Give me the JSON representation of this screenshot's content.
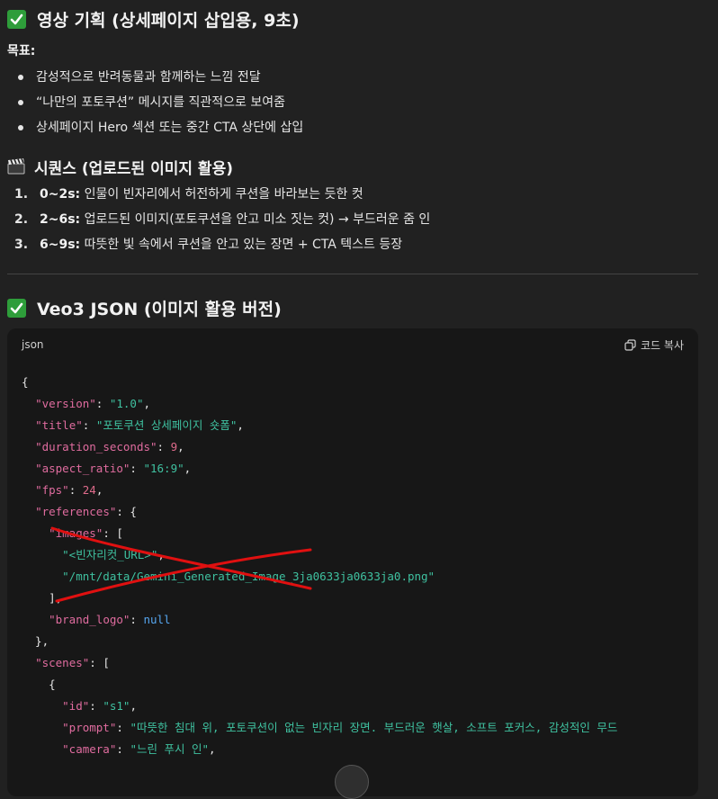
{
  "section1": {
    "title": "영상 기획 (상세페이지 삽입용, 9초)",
    "goal_label": "목표:",
    "goals": [
      "감성적으로 반려동물과 함께하는 느낌 전달",
      "“나만의 포토쿠션” 메시지를 직관적으로 보여줌",
      "상세페이지 Hero 섹션 또는 중간 CTA 상단에 삽입"
    ]
  },
  "section2": {
    "title": "시퀀스 (업로드된 이미지 활용)",
    "steps": [
      {
        "num": "1.",
        "time": "0~2s:",
        "text": " 인물이 빈자리에서 허전하게 쿠션을 바라보는 듯한 컷"
      },
      {
        "num": "2.",
        "time": "2~6s:",
        "text": " 업로드된 이미지(포토쿠션을 안고 미소 짓는 컷) → 부드러운 줌 인"
      },
      {
        "num": "3.",
        "time": "6~9s:",
        "text": " 따뜻한 빛 속에서 쿠션을 안고 있는 장면 + CTA 텍스트 등장"
      }
    ]
  },
  "section3": {
    "title": "Veo3 JSON (이미지 활용 버전)"
  },
  "code_block": {
    "language": "json",
    "copy_label": "코드 복사",
    "lines": [
      [
        [
          "p",
          "{"
        ]
      ],
      [
        [
          "p",
          "  "
        ],
        [
          "k",
          "\"version\""
        ],
        [
          "p",
          ": "
        ],
        [
          "s",
          "\"1.0\""
        ],
        [
          "p",
          ","
        ]
      ],
      [
        [
          "p",
          "  "
        ],
        [
          "k",
          "\"title\""
        ],
        [
          "p",
          ": "
        ],
        [
          "s",
          "\"포토쿠션 상세페이지 숏폼\""
        ],
        [
          "p",
          ","
        ]
      ],
      [
        [
          "p",
          "  "
        ],
        [
          "k",
          "\"duration_seconds\""
        ],
        [
          "p",
          ": "
        ],
        [
          "n",
          "9"
        ],
        [
          "p",
          ","
        ]
      ],
      [
        [
          "p",
          "  "
        ],
        [
          "k",
          "\"aspect_ratio\""
        ],
        [
          "p",
          ": "
        ],
        [
          "s",
          "\"16:9\""
        ],
        [
          "p",
          ","
        ]
      ],
      [
        [
          "p",
          "  "
        ],
        [
          "k",
          "\"fps\""
        ],
        [
          "p",
          ": "
        ],
        [
          "n",
          "24"
        ],
        [
          "p",
          ","
        ]
      ],
      [
        [
          "p",
          "  "
        ],
        [
          "k",
          "\"references\""
        ],
        [
          "p",
          ": {"
        ]
      ],
      [
        [
          "p",
          "    "
        ],
        [
          "k",
          "\"images\""
        ],
        [
          "p",
          ": ["
        ]
      ],
      [
        [
          "p",
          "      "
        ],
        [
          "s",
          "\"<빈자리컷_URL>\""
        ],
        [
          "p",
          ","
        ]
      ],
      [
        [
          "p",
          "      "
        ],
        [
          "s",
          "\"/mnt/data/Gemini_Generated_Image_3ja0633ja0633ja0.png\""
        ]
      ],
      [
        [
          "p",
          "    ],"
        ]
      ],
      [
        [
          "p",
          "    "
        ],
        [
          "k",
          "\"brand_logo\""
        ],
        [
          "p",
          ": "
        ],
        [
          "nl",
          "null"
        ]
      ],
      [
        [
          "p",
          "  },"
        ]
      ],
      [
        [
          "p",
          "  "
        ],
        [
          "k",
          "\"scenes\""
        ],
        [
          "p",
          ": ["
        ]
      ],
      [
        [
          "p",
          "    {"
        ]
      ],
      [
        [
          "p",
          "      "
        ],
        [
          "k",
          "\"id\""
        ],
        [
          "p",
          ": "
        ],
        [
          "s",
          "\"s1\""
        ],
        [
          "p",
          ","
        ]
      ],
      [
        [
          "p",
          "      "
        ],
        [
          "k",
          "\"prompt\""
        ],
        [
          "p",
          ": "
        ],
        [
          "s",
          "\"따뜻한 침대 위, 포토쿠션이 없는 빈자리 장면. 부드러운 햇살, 소프트 포커스, 감성적인 무드"
        ]
      ],
      [
        [
          "p",
          "      "
        ],
        [
          "k",
          "\"camera\""
        ],
        [
          "p",
          ": "
        ],
        [
          "s",
          "\"느린 푸시 인\""
        ],
        [
          "p",
          ","
        ]
      ]
    ]
  }
}
